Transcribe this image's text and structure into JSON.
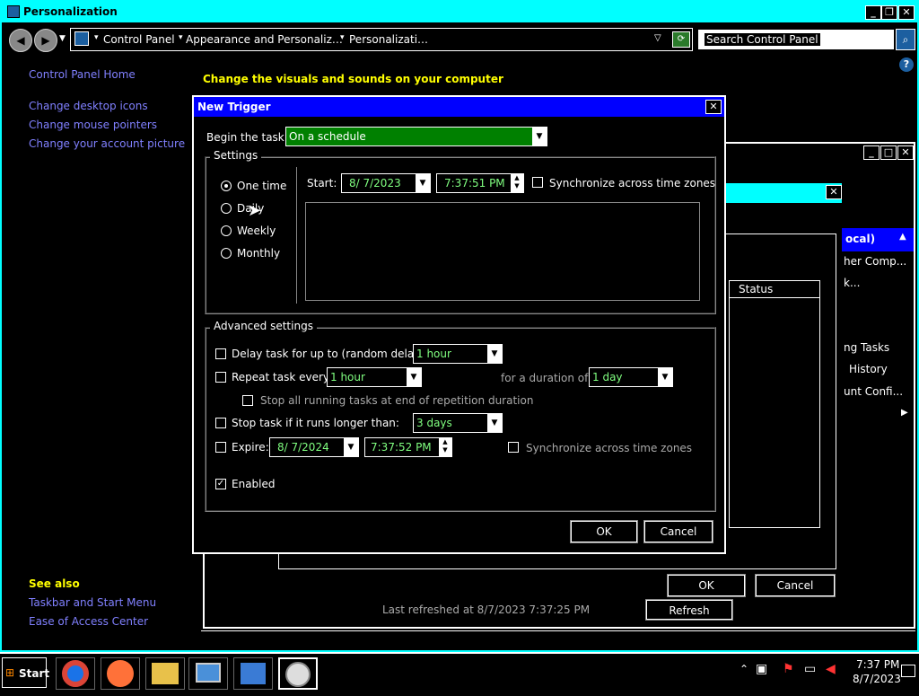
{
  "window": {
    "title": "Personalization",
    "minimize": "_",
    "restore": "❐",
    "close": "✕"
  },
  "address": {
    "crumb1": "Control Panel",
    "crumb2": "Appearance and Personaliz…",
    "crumb3": "Personalizati…",
    "search_placeholder": "Search Control Panel"
  },
  "sidebar": {
    "home": "Control Panel Home",
    "links": [
      "Change desktop icons",
      "Change mouse pointers",
      "Change your account picture"
    ],
    "see_also": "See also",
    "see_also_links": [
      "Taskbar and Start Menu",
      "Ease of Access Center"
    ]
  },
  "main": {
    "heading": "Change the visuals and sounds on your computer"
  },
  "background_window": {
    "local_label": "ocal)",
    "items": [
      "her Comp...",
      "k...",
      "ng Tasks",
      "History",
      "unt Confi..."
    ],
    "status_header": "Status",
    "last_refreshed": "Last refreshed at 8/7/2023 7:37:25 PM",
    "refresh_button": "Refresh",
    "ok_button": "OK",
    "cancel_button": "Cancel"
  },
  "dialog": {
    "title": "New Trigger",
    "begin_label": "Begin the task:",
    "begin_value": "On a schedule",
    "settings_legend": "Settings",
    "radios": [
      {
        "label": "One time",
        "selected": true
      },
      {
        "label": "Daily",
        "selected": false
      },
      {
        "label": "Weekly",
        "selected": false
      },
      {
        "label": "Monthly",
        "selected": false
      }
    ],
    "start_label": "Start:",
    "start_date": "8/ 7/2023",
    "start_time": "7:37:51 PM",
    "sync_label": "Synchronize across time zones",
    "advanced_legend": "Advanced settings",
    "delay_label": "Delay task for up to (random delay):",
    "delay_value": "1 hour",
    "repeat_label": "Repeat task every:",
    "repeat_value": "1 hour",
    "duration_label": "for a duration of:",
    "duration_value": "1 day",
    "stop_running_label": "Stop all running tasks at end of repetition duration",
    "stop_longer_label": "Stop task if it runs longer than:",
    "stop_longer_value": "3 days",
    "expire_label": "Expire:",
    "expire_date": "8/ 7/2024",
    "expire_time": "7:37:52 PM",
    "expire_sync_label": "Synchronize across time zones",
    "enabled_label": "Enabled",
    "enabled_checked": true,
    "ok": "OK",
    "cancel": "Cancel"
  },
  "taskbar": {
    "start": "Start",
    "clock_time": "7:37 PM",
    "clock_date": "8/7/2023"
  }
}
